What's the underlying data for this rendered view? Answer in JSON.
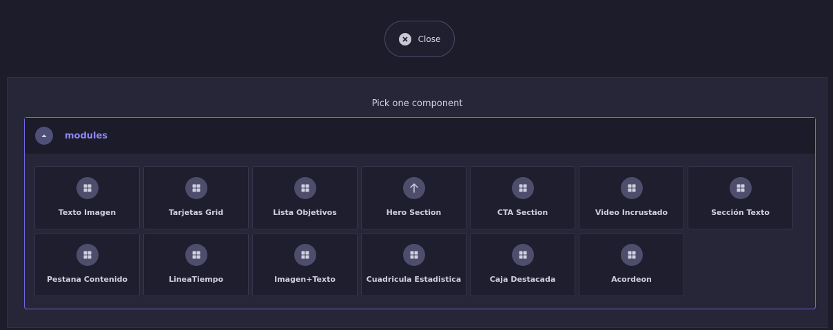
{
  "close_button": {
    "label": "Close",
    "icon": "close-circle-icon"
  },
  "panel": {
    "title": "Pick one component"
  },
  "group": {
    "label": "modules",
    "icon": "chevron-up-icon",
    "expanded": true
  },
  "components": [
    {
      "label": "Texto Imagen",
      "icon": "grid-icon"
    },
    {
      "label": "Tarjetas Grid",
      "icon": "grid-icon"
    },
    {
      "label": "Lista Objetivos",
      "icon": "grid-icon"
    },
    {
      "label": "Hero Section",
      "icon": "arrow-up-icon"
    },
    {
      "label": "CTA Section",
      "icon": "grid-icon"
    },
    {
      "label": "Video Incrustado",
      "icon": "grid-icon"
    },
    {
      "label": "Sección Texto",
      "icon": "grid-icon"
    },
    {
      "label": "Pestana Contenido",
      "icon": "grid-icon"
    },
    {
      "label": "LineaTiempo",
      "icon": "grid-icon"
    },
    {
      "label": "Imagen+Texto",
      "icon": "grid-icon"
    },
    {
      "label": "Cuadricula Estadistica",
      "icon": "grid-icon"
    },
    {
      "label": "Caja Destacada",
      "icon": "grid-icon"
    },
    {
      "label": "Acordeon",
      "icon": "grid-icon"
    }
  ],
  "colors": {
    "background": "#1c1c2b",
    "panel": "#262638",
    "accent": "#6f6ae0",
    "group_label": "#8f88f2"
  }
}
